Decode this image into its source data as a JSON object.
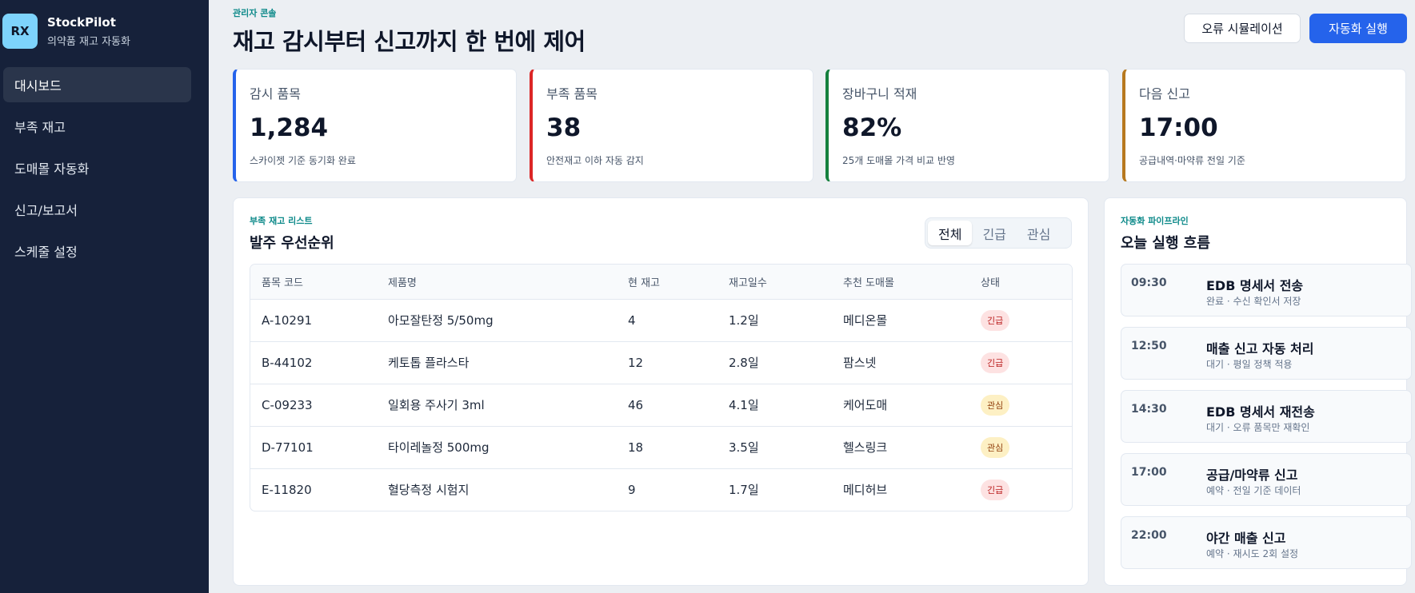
{
  "brand": {
    "logo": "RX",
    "name": "StockPilot",
    "subtitle": "의약품 재고 자동화"
  },
  "nav": {
    "items": [
      {
        "label": "대시보드",
        "active": true
      },
      {
        "label": "부족 재고",
        "active": false
      },
      {
        "label": "도매몰 자동화",
        "active": false
      },
      {
        "label": "신고/보고서",
        "active": false
      },
      {
        "label": "스케줄 설정",
        "active": false
      }
    ]
  },
  "header": {
    "eyebrow": "관리자 콘솔",
    "title": "재고 감시부터 신고까지 한 번에 제어",
    "simulate_label": "오류 시뮬레이션",
    "run_label": "자동화 실행"
  },
  "kpis": [
    {
      "label": "감시 품목",
      "value": "1,284",
      "note": "스카이젯 기준 동기화 완료",
      "color": "#2563eb"
    },
    {
      "label": "부족 품목",
      "value": "38",
      "note": "안전재고 이하 자동 감지",
      "color": "#dc2626"
    },
    {
      "label": "장바구니 적재",
      "value": "82%",
      "note": "25개 도매몰 가격 비교 반영",
      "color": "#15803d"
    },
    {
      "label": "다음 신고",
      "value": "17:00",
      "note": "공급내역·마약류 전일 기준",
      "color": "#b7791f"
    }
  ],
  "shortage": {
    "eyebrow": "부족 재고 리스트",
    "title": "발주 우선순위",
    "tabs": [
      {
        "label": "전체",
        "active": true
      },
      {
        "label": "긴급",
        "active": false
      },
      {
        "label": "관심",
        "active": false
      }
    ],
    "columns": [
      "품목 코드",
      "제품명",
      "현 재고",
      "재고일수",
      "추천 도매몰",
      "상태"
    ],
    "rows": [
      {
        "code": "A-10291",
        "name": "아모잘탄정 5/50mg",
        "stock": "4",
        "days": "1.2일",
        "vendor": "메디온몰",
        "status": "긴급",
        "level": "urgent"
      },
      {
        "code": "B-44102",
        "name": "케토톱 플라스타",
        "stock": "12",
        "days": "2.8일",
        "vendor": "팜스넷",
        "status": "긴급",
        "level": "urgent"
      },
      {
        "code": "C-09233",
        "name": "일회용 주사기 3ml",
        "stock": "46",
        "days": "4.1일",
        "vendor": "케어도매",
        "status": "관심",
        "level": "watch"
      },
      {
        "code": "D-77101",
        "name": "타이레놀정 500mg",
        "stock": "18",
        "days": "3.5일",
        "vendor": "헬스링크",
        "status": "관심",
        "level": "watch"
      },
      {
        "code": "E-11820",
        "name": "혈당측정 시험지",
        "stock": "9",
        "days": "1.7일",
        "vendor": "메디허브",
        "status": "긴급",
        "level": "urgent"
      }
    ]
  },
  "pipeline": {
    "eyebrow": "자동화 파이프라인",
    "title": "오늘 실행 흐름",
    "steps": [
      {
        "time": "09:30",
        "title": "EDB 명세서 전송",
        "desc": "완료 · 수신 확인서 저장"
      },
      {
        "time": "12:50",
        "title": "매출 신고 자동 처리",
        "desc": "대기 · 평일 정책 적용"
      },
      {
        "time": "14:30",
        "title": "EDB 명세서 재전송",
        "desc": "대기 · 오류 품목만 재확인"
      },
      {
        "time": "17:00",
        "title": "공급/마약류 신고",
        "desc": "예약 · 전일 기준 데이터"
      },
      {
        "time": "22:00",
        "title": "야간 매출 신고",
        "desc": "예약 · 재시도 2회 설정"
      }
    ]
  }
}
